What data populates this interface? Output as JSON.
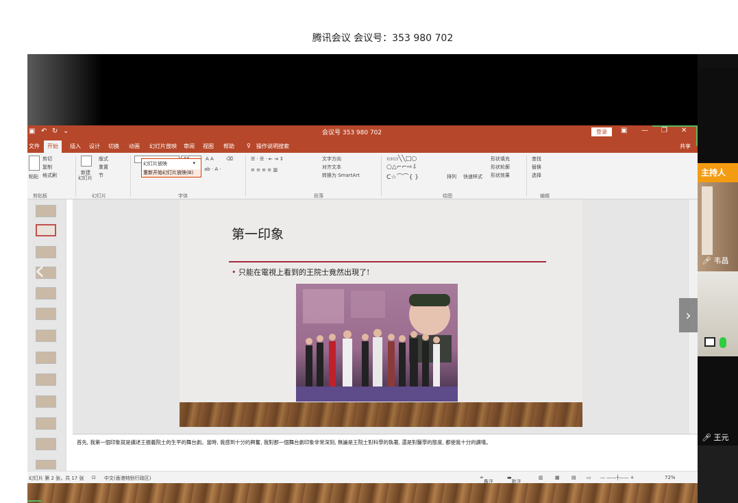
{
  "meeting": {
    "title": "腾讯会议 会议号：353 980 702"
  },
  "ppt": {
    "doc_title": "会议号 353 980 702",
    "signin": "登录",
    "share": "共享",
    "tabs": [
      "文件",
      "开始",
      "插入",
      "设计",
      "切换",
      "动画",
      "幻灯片放映",
      "审阅",
      "视图",
      "帮助",
      "操作说明搜索"
    ],
    "active_tab": "开始",
    "ribbon": {
      "clipboard": {
        "cut": "剪切",
        "copy": "复制",
        "format_painter": "格式刷",
        "paste": "粘贴",
        "label": "剪贴板"
      },
      "slides": {
        "layout": "版式",
        "reset": "重置",
        "section": "节",
        "new_slide": "新建",
        "new_slide2": "幻灯片",
        "label": "幻灯片"
      },
      "font": {
        "size": "66",
        "label": "字体"
      },
      "slideshow_dropdown": "幻灯片放映",
      "restart_slideshow": "重新开始幻灯片放映(B)",
      "paragraph": {
        "text_direction": "文字方向",
        "align_text": "对齐文本",
        "smartart": "转换为 SmartArt",
        "label": "段落"
      },
      "drawing": {
        "arrange": "排列",
        "quick_styles": "快速样式",
        "shape_fill": "形状填充",
        "shape_outline": "形状轮廓",
        "shape_effects": "形状效果",
        "label": "绘图"
      },
      "editing": {
        "find": "查找",
        "replace": "替换",
        "select": "选择",
        "label": "编辑"
      }
    },
    "slide": {
      "title": "第一印象",
      "bullet": "只能在電視上看到的王院士竟然出現了!"
    },
    "notes": "首先, 我第一個印象就是講述王振義院士的生平的舞台劇。當時, 我感到十分的興奮, 我對那一個舞台劇印象非常深刻, 無論是王院士對科學的執著, 還是對醫學的態度, 都使我十分的讚嘆。",
    "status": {
      "slide_info": "幻灯片 第 2 张，共 17 张",
      "language": "中文(香港特别行政区)",
      "notes_btn": "备注",
      "comments_btn": "批注",
      "zoom": "72%"
    }
  },
  "participants": {
    "host_label": "主持人",
    "names": [
      "韦昌",
      "王元"
    ]
  },
  "colors": {
    "ppt_accent": "#b7472a",
    "host_badge": "#f39c12",
    "slide_rule": "#a6283b"
  }
}
